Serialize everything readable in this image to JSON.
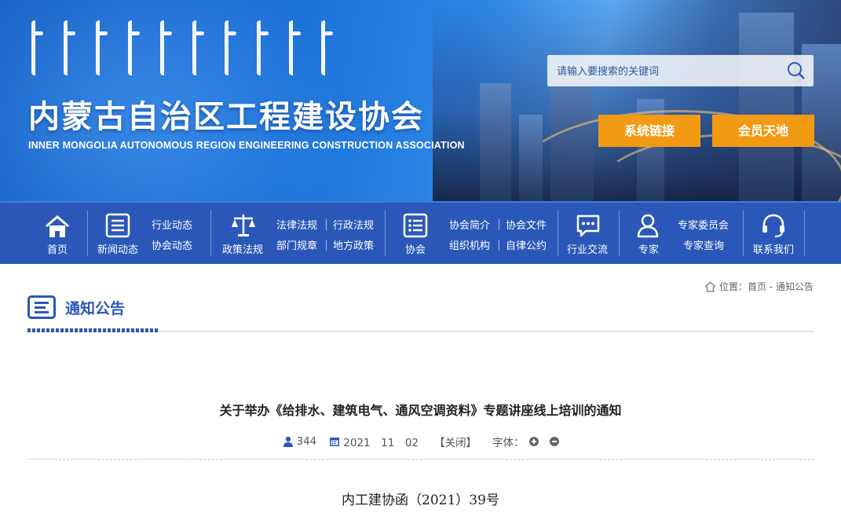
{
  "header": {
    "org_name_cn": "内蒙古自治区工程建设协会",
    "org_name_en": "INNER MONGOLIA AUTONOMOUS REGION ENGINEERING CONSTRUCTION ASSOCIATION",
    "search_placeholder": "请输入要搜索的关键词",
    "system_links_label": "系统链接",
    "member_area_label": "会员天地"
  },
  "nav": {
    "home": "首页",
    "news": "新闻动态",
    "industry_news": "行业动态",
    "assoc_news": "协会动态",
    "policy": "政策法规",
    "laws": "法律法规",
    "admin_regs": "行政法规",
    "dept_rules": "部门规章",
    "local_policy": "地方政策",
    "assoc": "协会",
    "assoc_intro": "协会简介",
    "assoc_docs": "协会文件",
    "org_structure": "组织机构",
    "self_discipline": "自律公约",
    "exchange": "行业交流",
    "expert": "专家",
    "expert_committee": "专家委员会",
    "expert_query": "专家查询",
    "contact": "联系我们"
  },
  "breadcrumb": {
    "label": "位置：首页 - 通知公告"
  },
  "section": {
    "title": "通知公告"
  },
  "article": {
    "title": "关于举办《给排水、建筑电气、通风空调资料》专题讲座线上培训的通知",
    "views": "344",
    "date": "2021　11　02",
    "close": "【关闭】",
    "font_label": "字体：",
    "doc_number": "内工建协函（2021）39号"
  },
  "colors": {
    "brand_blue": "#2b58b8",
    "accent_orange": "#f39a14"
  }
}
